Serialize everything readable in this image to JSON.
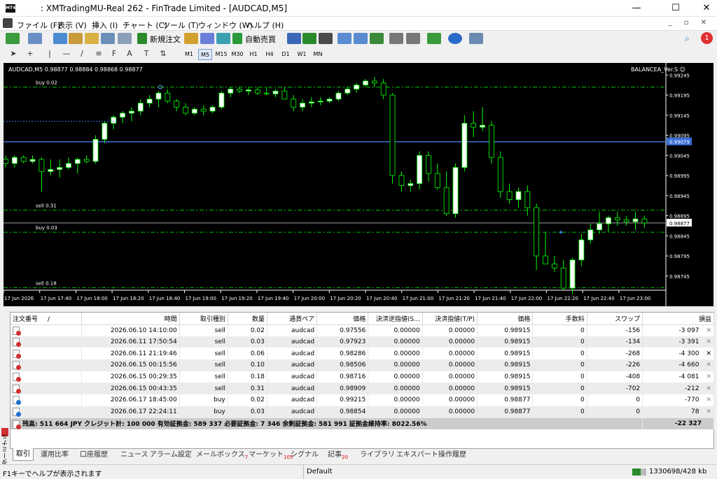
{
  "window": {
    "title": ": XMTradingMU-Real 262 - FinTrade Limited - [AUDCAD,M5]",
    "minimize": "—",
    "maximize": "☐",
    "close": "✕"
  },
  "menu": [
    "ファイル (F)",
    "表示 (V)",
    "挿入 (I)",
    "チャート (C)",
    "ツール (T)",
    "ウィンドウ (W)",
    "ヘルプ (H)"
  ],
  "toolbar": {
    "new_order": "新規注文",
    "auto_trade": "自動売買",
    "notification_count": "1"
  },
  "toolbar2": {
    "cursor": "➤",
    "crosshair": "+",
    "vline": "|",
    "hline": "—",
    "trendline": "/",
    "channel": "≡",
    "fibo": "F",
    "text": "A",
    "label": "T",
    "arrows": "⇅"
  },
  "timeframes": [
    "M1",
    "M5",
    "M15",
    "M30",
    "H1",
    "H4",
    "D1",
    "W1",
    "MN"
  ],
  "active_timeframe": "M5",
  "chart": {
    "header": "AUDCAD,M5  0.98877 0.98884 0.98868 0.98877",
    "ea_name": "BALANCEA_Ver.S ☺",
    "price_labels": [
      "0.99245",
      "0.99195",
      "0.99145",
      "0.99095",
      "0.99079",
      "0.99045",
      "0.98995",
      "0.98945",
      "0.98895",
      "0.98877",
      "0.98845",
      "0.98795",
      "0.98745"
    ],
    "time_labels": [
      "17 Jun 2026",
      "17 Jun 17:40",
      "17 Jun 18:00",
      "17 Jun 18:20",
      "17 Jun 18:40",
      "17 Jun 19:00",
      "17 Jun 19:20",
      "17 Jun 19:40",
      "17 Jun 20:00",
      "17 Jun 20:20",
      "17 Jun 20:40",
      "17 Jun 21:00",
      "17 Jun 21:20",
      "17 Jun 21:40",
      "17 Jun 22:00",
      "17 Jun 22:20",
      "17 Jun 22:40",
      "17 Jun 23:00"
    ],
    "order_lines": [
      {
        "label": "buy 0.02",
        "price": 0.99215
      },
      {
        "label": "sell 0.31",
        "price": 0.98909
      },
      {
        "label": "buy 0.03",
        "price": 0.98854
      },
      {
        "label": "sell 0.18",
        "price": 0.98716
      }
    ],
    "bid_price": 0.98877,
    "blue_line_price": 0.99079,
    "candles": [
      [
        0.99036,
        0.99045,
        0.99015,
        0.99025
      ],
      [
        0.99025,
        0.99045,
        0.99015,
        0.9904
      ],
      [
        0.9904,
        0.99045,
        0.99025,
        0.9903
      ],
      [
        0.9903,
        0.99045,
        0.99025,
        0.99035
      ],
      [
        0.99035,
        0.9904,
        0.98955,
        0.99005
      ],
      [
        0.99005,
        0.99035,
        0.98995,
        0.9901
      ],
      [
        0.9901,
        0.99035,
        0.9899,
        0.99015
      ],
      [
        0.99015,
        0.9904,
        0.9901,
        0.99025
      ],
      [
        0.99025,
        0.9904,
        0.99,
        0.99035
      ],
      [
        0.99035,
        0.99045,
        0.99025,
        0.9903
      ],
      [
        0.9903,
        0.99095,
        0.99025,
        0.99085
      ],
      [
        0.99085,
        0.9913,
        0.99075,
        0.99125
      ],
      [
        0.99125,
        0.99145,
        0.9911,
        0.9914
      ],
      [
        0.9914,
        0.99155,
        0.99125,
        0.9915
      ],
      [
        0.9915,
        0.99165,
        0.9913,
        0.99155
      ],
      [
        0.99155,
        0.99185,
        0.99145,
        0.99175
      ],
      [
        0.99175,
        0.99195,
        0.99165,
        0.99185
      ],
      [
        0.99185,
        0.99205,
        0.99165,
        0.992
      ],
      [
        0.992,
        0.9921,
        0.99175,
        0.9918
      ],
      [
        0.9918,
        0.99185,
        0.99155,
        0.99165
      ],
      [
        0.99165,
        0.99175,
        0.99145,
        0.9915
      ],
      [
        0.9915,
        0.99165,
        0.99145,
        0.9916
      ],
      [
        0.9916,
        0.9917,
        0.99145,
        0.99155
      ],
      [
        0.99155,
        0.9917,
        0.9915,
        0.99165
      ],
      [
        0.99165,
        0.99205,
        0.9916,
        0.992
      ],
      [
        0.992,
        0.99215,
        0.9919,
        0.9921
      ],
      [
        0.9921,
        0.99215,
        0.992,
        0.99205
      ],
      [
        0.99205,
        0.99215,
        0.99195,
        0.99208
      ],
      [
        0.99208,
        0.99215,
        0.99195,
        0.992
      ],
      [
        0.992,
        0.99215,
        0.99195,
        0.99198
      ],
      [
        0.99198,
        0.9921,
        0.9919,
        0.99205
      ],
      [
        0.99205,
        0.99215,
        0.99195,
        0.99185
      ],
      [
        0.99185,
        0.99195,
        0.99155,
        0.99165
      ],
      [
        0.99165,
        0.99185,
        0.99155,
        0.99175
      ],
      [
        0.99175,
        0.9919,
        0.99165,
        0.99178
      ],
      [
        0.99178,
        0.9919,
        0.9917,
        0.9918
      ],
      [
        0.9918,
        0.9919,
        0.99175,
        0.99185
      ],
      [
        0.99185,
        0.99205,
        0.9918,
        0.992
      ],
      [
        0.992,
        0.99215,
        0.99195,
        0.9921
      ],
      [
        0.9921,
        0.99225,
        0.992,
        0.9922
      ],
      [
        0.9922,
        0.99235,
        0.99215,
        0.9923
      ],
      [
        0.9923,
        0.9924,
        0.99215,
        0.99225
      ],
      [
        0.99225,
        0.99235,
        0.99185,
        0.99195
      ],
      [
        0.99195,
        0.992,
        0.98975,
        0.98995
      ],
      [
        0.98995,
        0.99005,
        0.98955,
        0.9897
      ],
      [
        0.9897,
        0.98985,
        0.98955,
        0.98975
      ],
      [
        0.98975,
        0.99055,
        0.9896,
        0.99045
      ],
      [
        0.99045,
        0.99055,
        0.9898,
        0.99
      ],
      [
        0.99,
        0.99025,
        0.9896,
        0.98965
      ],
      [
        0.98965,
        0.99005,
        0.98895,
        0.989
      ],
      [
        0.989,
        0.99025,
        0.9889,
        0.99015
      ],
      [
        0.99015,
        0.99145,
        0.99005,
        0.99125
      ],
      [
        0.99125,
        0.99155,
        0.9909,
        0.99115
      ],
      [
        0.99115,
        0.99165,
        0.99105,
        0.9912
      ],
      [
        0.9912,
        0.9913,
        0.99025,
        0.9904
      ],
      [
        0.9904,
        0.99055,
        0.9894,
        0.98955
      ],
      [
        0.98955,
        0.98975,
        0.98925,
        0.98935
      ],
      [
        0.98935,
        0.98965,
        0.98915,
        0.98955
      ],
      [
        0.98955,
        0.9897,
        0.98895,
        0.98915
      ],
      [
        0.98915,
        0.98925,
        0.9876,
        0.98795
      ],
      [
        0.98795,
        0.98855,
        0.98775,
        0.98775
      ],
      [
        0.98775,
        0.98795,
        0.98755,
        0.98765
      ],
      [
        0.98765,
        0.98785,
        0.9871,
        0.98715
      ],
      [
        0.98715,
        0.9879,
        0.987,
        0.98785
      ],
      [
        0.98785,
        0.9885,
        0.9877,
        0.98835
      ],
      [
        0.98835,
        0.98875,
        0.98825,
        0.9886
      ],
      [
        0.9886,
        0.98905,
        0.9885,
        0.98875
      ],
      [
        0.98875,
        0.98895,
        0.98855,
        0.9889
      ],
      [
        0.9889,
        0.98905,
        0.9887,
        0.98885
      ],
      [
        0.98885,
        0.98895,
        0.9887,
        0.9888
      ],
      [
        0.9888,
        0.98905,
        0.9886,
        0.98887
      ],
      [
        0.98887,
        0.98895,
        0.98865,
        0.98877
      ]
    ],
    "axis_title_right": ""
  },
  "terminal": {
    "side_label": "ターミナル",
    "columns": [
      "注文番号",
      "時間",
      "取引種別",
      "数量",
      "通貨ペア",
      "価格",
      "決済逆指値(S...",
      "決済指値(T/P)",
      "価格",
      "手数料",
      "スワップ",
      "損益"
    ],
    "sort_indicator": "/",
    "rows": [
      {
        "time": "2026.06.10 14:10:00",
        "type": "sell",
        "vol": "0.02",
        "sym": "audcad",
        "price": "0.97556",
        "sl": "0.00000",
        "tp": "0.00000",
        "cur": "0.98915",
        "comm": "0",
        "swap": "-156",
        "pl": "-3 097"
      },
      {
        "time": "2026.06.11 17:50:54",
        "type": "sell",
        "vol": "0.03",
        "sym": "audcad",
        "price": "0.97923",
        "sl": "0.00000",
        "tp": "0.00000",
        "cur": "0.98915",
        "comm": "0",
        "swap": "-134",
        "pl": "-3 391"
      },
      {
        "time": "2026.06.11 21:19:46",
        "type": "sell",
        "vol": "0.06",
        "sym": "audcad",
        "price": "0.98286",
        "sl": "0.00000",
        "tp": "0.00000",
        "cur": "0.98915",
        "comm": "0",
        "swap": "-268",
        "pl": "-4 300"
      },
      {
        "time": "2026.06.15 00:15:56",
        "type": "sell",
        "vol": "0.10",
        "sym": "audcad",
        "price": "0.98506",
        "sl": "0.00000",
        "tp": "0.00000",
        "cur": "0.98915",
        "comm": "0",
        "swap": "-226",
        "pl": "-4 660"
      },
      {
        "time": "2026.06.15 00:29:35",
        "type": "sell",
        "vol": "0.18",
        "sym": "audcad",
        "price": "0.98716",
        "sl": "0.00000",
        "tp": "0.00000",
        "cur": "0.98915",
        "comm": "0",
        "swap": "-408",
        "pl": "-4 081"
      },
      {
        "time": "2026.06.15 00:43:35",
        "type": "sell",
        "vol": "0.31",
        "sym": "audcad",
        "price": "0.98909",
        "sl": "0.00000",
        "tp": "0.00000",
        "cur": "0.98915",
        "comm": "0",
        "swap": "-702",
        "pl": "-212"
      },
      {
        "time": "2026.06.17 18:45:00",
        "type": "buy",
        "vol": "0.02",
        "sym": "audcad",
        "price": "0.99215",
        "sl": "0.00000",
        "tp": "0.00000",
        "cur": "0.98877",
        "comm": "0",
        "swap": "0",
        "pl": "-770"
      },
      {
        "time": "2026.06.17 22:24:11",
        "type": "buy",
        "vol": "0.03",
        "sym": "audcad",
        "price": "0.98854",
        "sl": "0.00000",
        "tp": "0.00000",
        "cur": "0.98877",
        "comm": "0",
        "swap": "0",
        "pl": "78"
      }
    ],
    "summary": "残高: 511 664 JPY  クレジット計: 100 000  有効証拠金: 589 337  必要証拠金: 7 346  余剰証拠金: 581 991  証拠金維持率: 8022.56%",
    "summary_pl": "-22 327",
    "close_x": "✕"
  },
  "tabs": [
    {
      "label": "取引",
      "badge": ""
    },
    {
      "label": "運用比率",
      "badge": ""
    },
    {
      "label": "口座履歴",
      "badge": ""
    },
    {
      "label": "ニュース",
      "badge": ""
    },
    {
      "label": "アラーム設定",
      "badge": ""
    },
    {
      "label": "メールボックス",
      "badge": "7"
    },
    {
      "label": "マーケット",
      "badge": "105"
    },
    {
      "label": "シグナル",
      "badge": ""
    },
    {
      "label": "記事",
      "badge": "20"
    },
    {
      "label": "ライブラリ",
      "badge": ""
    },
    {
      "label": "エキスパート",
      "badge": ""
    },
    {
      "label": "操作履歴",
      "badge": ""
    }
  ],
  "status": {
    "help": "F1キーでヘルプが表示されます",
    "profile": "Default",
    "traffic": "1330698/428 kb"
  },
  "colors": {
    "bull": "#ffffff",
    "bear": "#000000",
    "wick": "#00ff00",
    "order_line": "#00c000",
    "blue_line": "#3a6fd8",
    "bid_line": "#a0a0a0",
    "sell_icon": "#d03030",
    "buy_icon": "#2070d0"
  }
}
